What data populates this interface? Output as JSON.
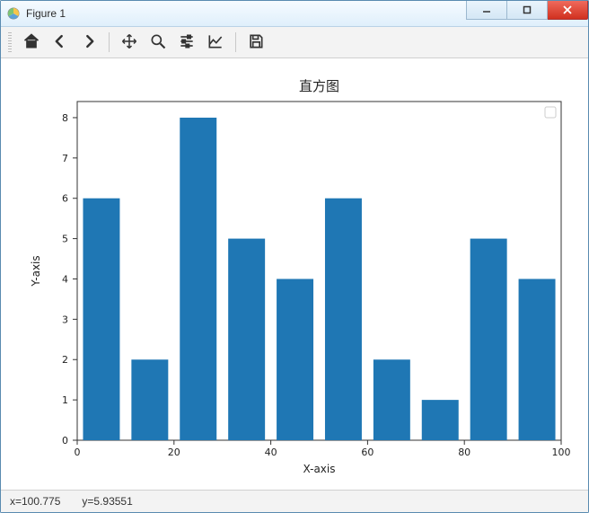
{
  "window": {
    "title": "Figure 1"
  },
  "toolbar": {
    "home": "home-icon",
    "back": "back-icon",
    "forward": "forward-icon",
    "pan": "pan-icon",
    "zoom": "zoom-icon",
    "configure": "configure-icon",
    "edit": "axes-edit-icon",
    "save": "save-icon"
  },
  "status": {
    "x_label": "x=100.775",
    "y_label": "y=5.93551"
  },
  "chart_data": {
    "type": "bar",
    "title": "直方图",
    "xlabel": "X-axis",
    "ylabel": "Y-axis",
    "bin_edges": [
      0,
      10,
      20,
      30,
      40,
      50,
      60,
      70,
      80,
      90,
      100
    ],
    "values": [
      6,
      2,
      8,
      5,
      4,
      6,
      2,
      1,
      5,
      4
    ],
    "x_ticks": [
      0,
      20,
      40,
      60,
      80,
      100
    ],
    "y_ticks": [
      0,
      1,
      2,
      3,
      4,
      5,
      6,
      7,
      8
    ],
    "xlim": [
      0,
      100
    ],
    "ylim": [
      0,
      8.4
    ],
    "bar_color": "#1f77b4",
    "legend_visible": true
  }
}
